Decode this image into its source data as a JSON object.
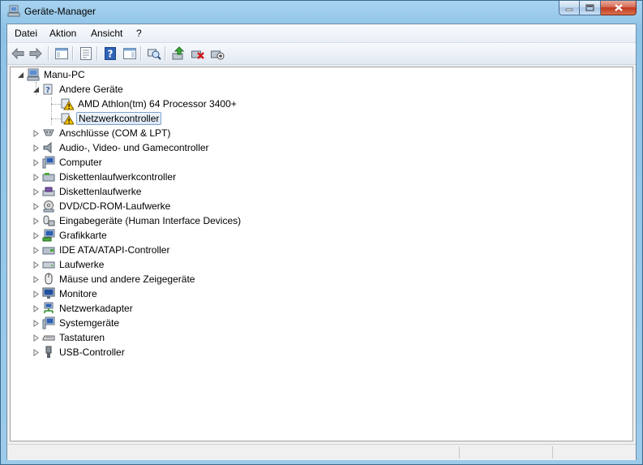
{
  "window": {
    "title": "Geräte-Manager"
  },
  "menu": [
    "Datei",
    "Aktion",
    "Ansicht",
    "?"
  ],
  "toolbar": {
    "buttons": [
      "back-arrow-icon",
      "forward-arrow-icon",
      "show-hide-console-tree-icon",
      "properties-icon",
      "help-icon",
      "show-action-pane-icon",
      "scan-hardware-icon",
      "update-driver-icon",
      "uninstall-device-icon",
      "disable-device-icon"
    ]
  },
  "tree": {
    "root": "Manu-PC",
    "andere": "Andere Geräte",
    "amd": "AMD Athlon(tm) 64 Processor 3400+",
    "netzwerkcontroller": "Netzwerkcontroller",
    "categories": [
      "Anschlüsse (COM & LPT)",
      "Audio-, Video- und Gamecontroller",
      "Computer",
      "Diskettenlaufwerkcontroller",
      "Diskettenlaufwerke",
      "DVD/CD-ROM-Laufwerke",
      "Eingabegeräte (Human Interface Devices)",
      "Grafikkarte",
      "IDE ATA/ATAPI-Controller",
      "Laufwerke",
      "Mäuse und andere Zeigegeräte",
      "Monitore",
      "Netzwerkadapter",
      "Systemgeräte",
      "Tastaturen",
      "USB-Controller"
    ]
  },
  "colors": {
    "selection_border": "#7da2ce",
    "warning": "#f2c200",
    "titlebar": "#9ccbea"
  }
}
